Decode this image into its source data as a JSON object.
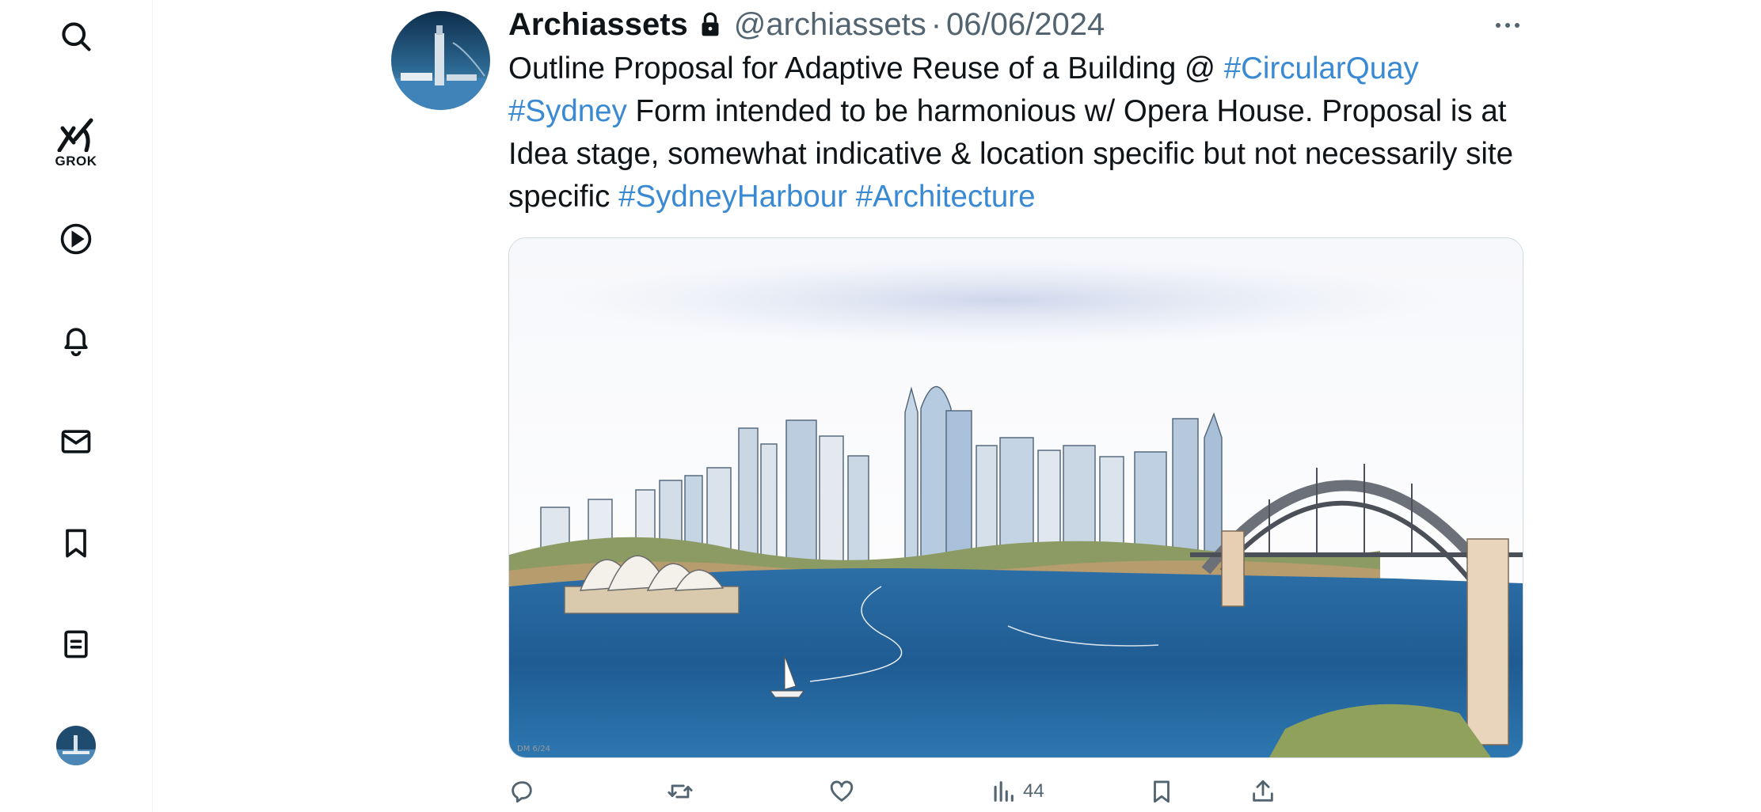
{
  "sidebar": {
    "items": [
      {
        "name": "search",
        "icon": "search-icon"
      },
      {
        "name": "grok",
        "icon": "grok-icon",
        "label": "GROK"
      },
      {
        "name": "videos",
        "icon": "play-circle-icon"
      },
      {
        "name": "notifications",
        "icon": "bell-icon"
      },
      {
        "name": "messages",
        "icon": "mail-icon"
      },
      {
        "name": "bookmarks",
        "icon": "bookmark-icon"
      },
      {
        "name": "lists",
        "icon": "list-document-icon"
      },
      {
        "name": "profile",
        "icon": "profile-avatar"
      }
    ]
  },
  "tweet": {
    "display_name": "Archiassets",
    "protected_icon": "lock-icon",
    "handle": "@archiassets",
    "separator": "·",
    "date": "06/06/2024",
    "more_icon": "more-horizontal-icon",
    "text": {
      "part1": "Outline Proposal for Adaptive Reuse of a Building @ ",
      "tag1": "#CircularQuay",
      "tag2": "#Sydney",
      "part2": " Form intended to be harmonious w/ Opera House. Proposal is at Idea stage, somewhat indicative & location specific but not necessarily site specific ",
      "tag3": "#SydneyHarbour",
      "tag4": "#Architecture"
    },
    "media": {
      "alt": "Sketch of Sydney skyline with Opera House and Harbour Bridge",
      "signature": "DM 6/24"
    },
    "actions": {
      "reply_icon": "reply-icon",
      "retweet_icon": "retweet-icon",
      "like_icon": "heart-icon",
      "views_icon": "views-icon",
      "views_count": "44",
      "bookmark_icon": "bookmark-icon",
      "share_icon": "share-icon"
    }
  },
  "colors": {
    "link": "#3a8ad3",
    "secondary_text": "#536471",
    "border": "#cfd9de"
  }
}
